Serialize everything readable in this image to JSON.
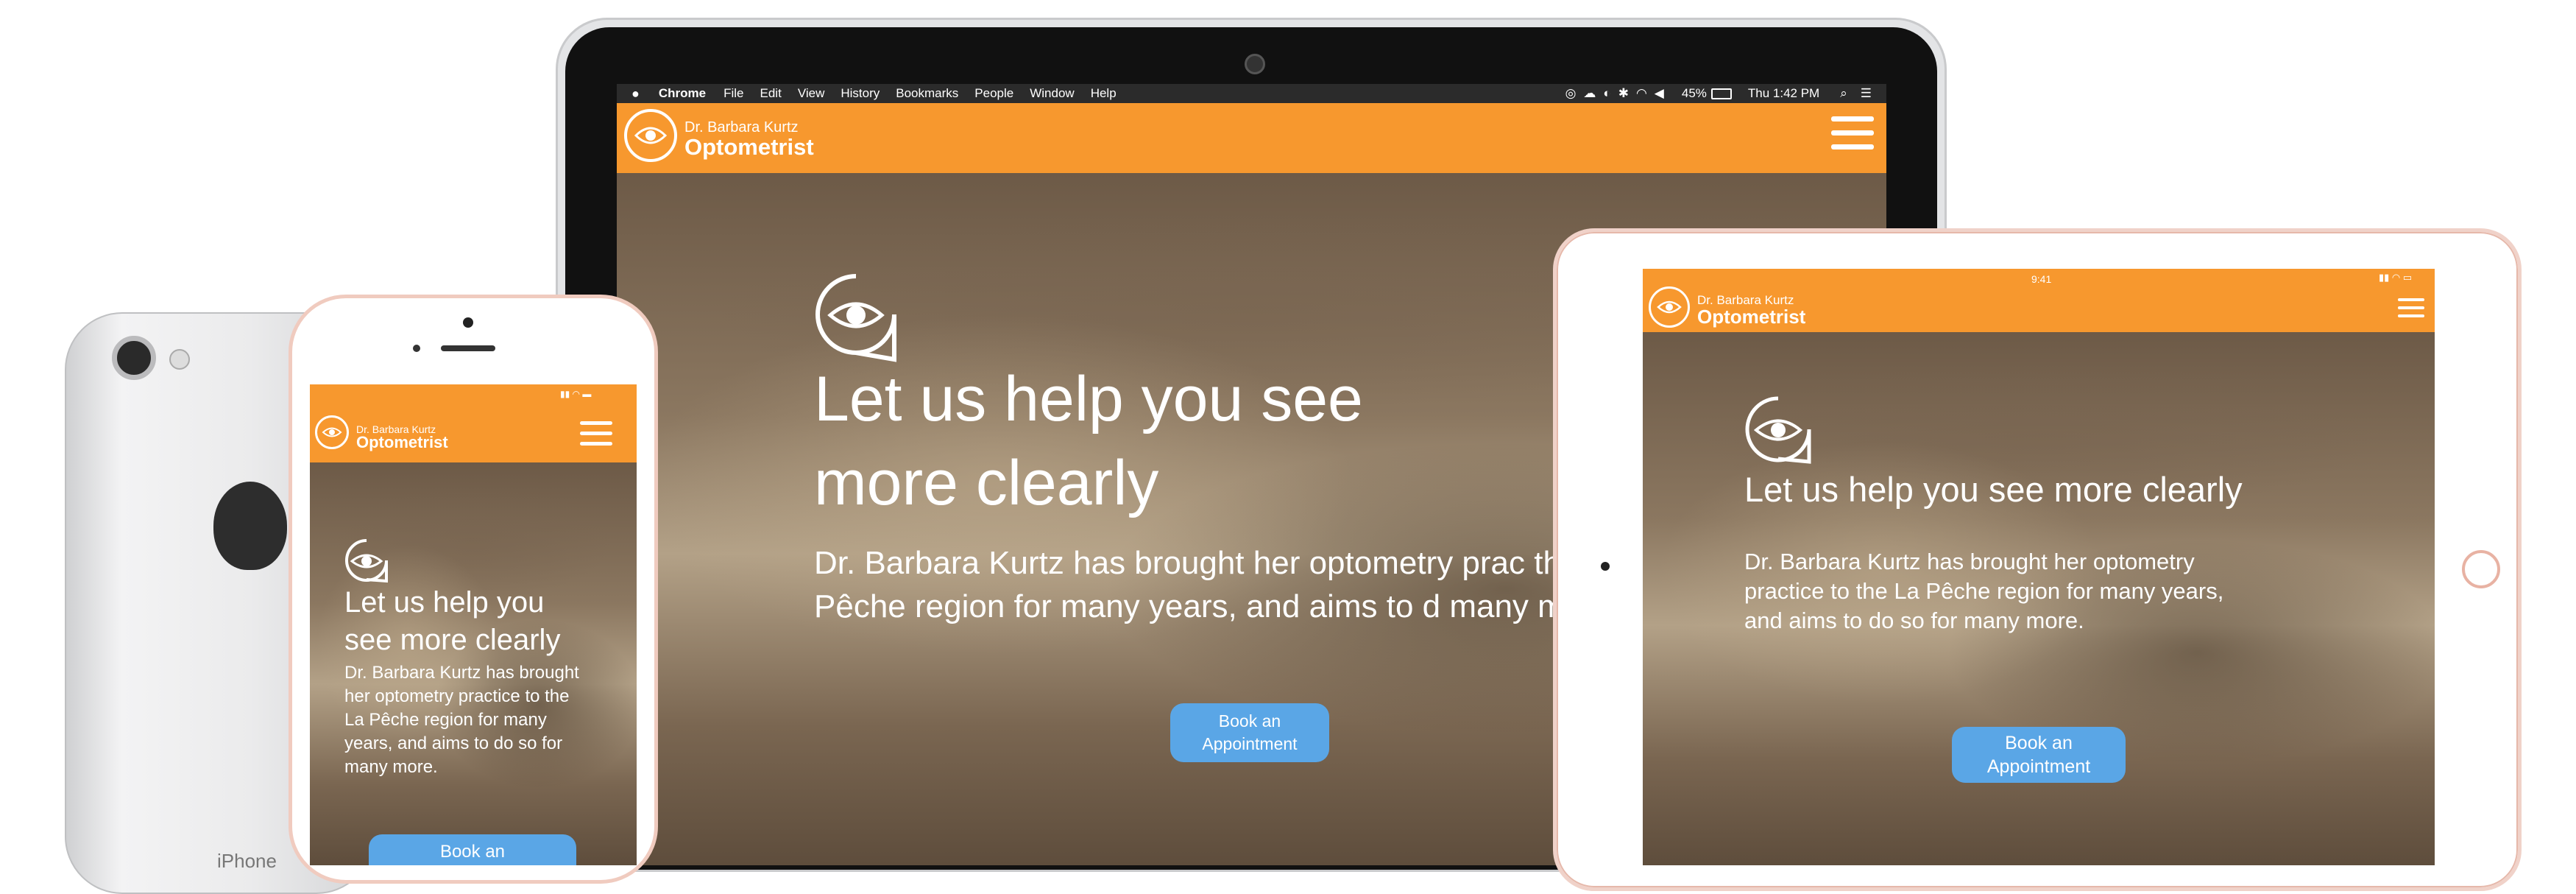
{
  "mac_menubar": {
    "app": "Chrome",
    "menus": [
      "File",
      "Edit",
      "View",
      "History",
      "Bookmarks",
      "People",
      "Window",
      "Help"
    ],
    "battery": "45%",
    "clock": "Thu 1:42 PM"
  },
  "site": {
    "brand_line1": "Dr. Barbara Kurtz",
    "brand_line2": "Optometrist",
    "headline": "Let us help you see more clearly",
    "headline_laptop_1": "Let us help you see",
    "headline_laptop_2": "more clearly",
    "headline_phone_1": "Let us help you",
    "headline_phone_2": "see more clearly",
    "body_laptop": "Dr. Barbara Kurtz has brought her optometry prac the La Pêche region for many years, and aims to d many more.",
    "body": "Dr. Barbara Kurtz has brought her optometry practice to the La Pêche region for many years, and aims to do so for many more.",
    "button": "Book an Appointment",
    "button_phone": "Book an"
  },
  "ipad_status": {
    "time": "9:41"
  },
  "iphone_back": {
    "label": "iPhone"
  },
  "colors": {
    "orange": "#f7982e",
    "button_blue": "#5aa6e6",
    "menubar": "#2b2b2b"
  }
}
